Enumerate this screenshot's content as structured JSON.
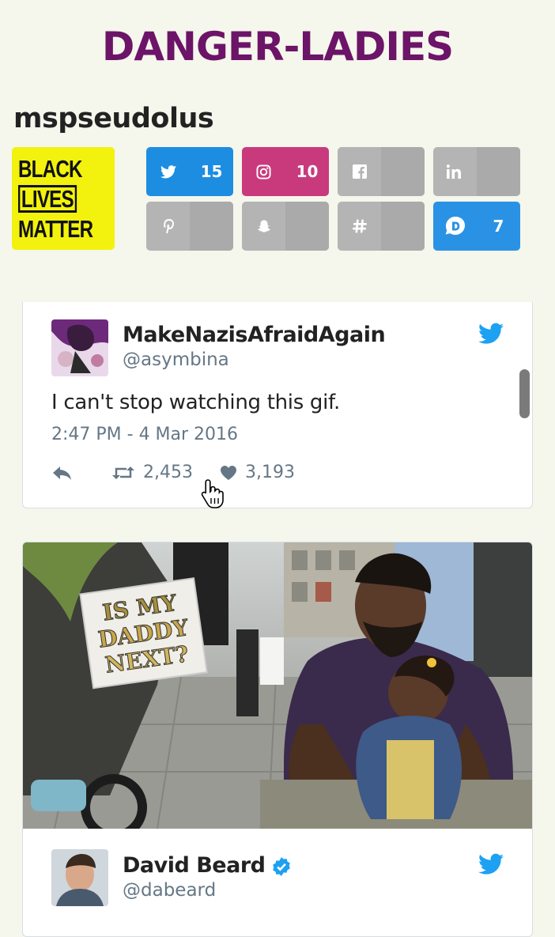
{
  "site": {
    "title": "DANGER-LADIES"
  },
  "profile": {
    "username": "mspseudolus",
    "avatar_lines": [
      "BLACK",
      "LIVES",
      "MATTER"
    ]
  },
  "social": [
    {
      "name": "twitter",
      "icon": "twitter-icon",
      "count": "15",
      "color": "#1d8de2"
    },
    {
      "name": "instagram",
      "icon": "instagram-icon",
      "count": "10",
      "color": "#c93a7d"
    },
    {
      "name": "facebook",
      "icon": "facebook-icon",
      "count": "",
      "color": "#b4b4b4"
    },
    {
      "name": "linkedin",
      "icon": "linkedin-icon",
      "count": "",
      "color": "#b4b4b4"
    },
    {
      "name": "pinterest",
      "icon": "pinterest-icon",
      "count": "",
      "color": "#b4b4b4"
    },
    {
      "name": "snapchat",
      "icon": "snapchat-icon",
      "count": "",
      "color": "#b4b4b4"
    },
    {
      "name": "slack",
      "icon": "hashtag-icon",
      "count": "",
      "color": "#b4b4b4"
    },
    {
      "name": "disqus",
      "icon": "disqus-icon",
      "count": "7",
      "color": "#2a92e5"
    }
  ],
  "tweets": [
    {
      "name": "MakeNazisAfraidAgain",
      "handle": "@asymbina",
      "text": "I can't stop watching this gif.",
      "date": "2:47 PM - 4 Mar 2016",
      "retweets": "2,453",
      "likes": "3,193"
    },
    {
      "name": "David Beard",
      "handle": "@dabeard",
      "verified": true,
      "image_sign_text": [
        "IS MY",
        "DADDY",
        "NEXT?"
      ]
    }
  ],
  "colors": {
    "title": "#6c1468",
    "background": "#f5f6ec",
    "twitter_blue": "#1da1f2"
  }
}
